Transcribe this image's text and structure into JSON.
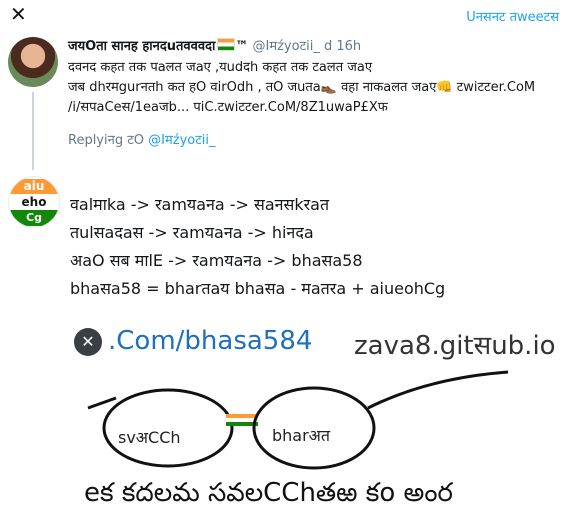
{
  "header": {
    "close_icon": "close-icon",
    "link": "Uनसनट तweeटस"
  },
  "parent": {
    "name": "जयOता सानह हानदuतवववदा",
    "badge": "™",
    "handle": "@Iमźyoटii_",
    "time": "d 16h",
    "lines": [
      "दवनद कहत तक पaलत जaए ,यudदh कहत तक टaलत जaए",
      "जब dhरमgurनतh कत हO वirOdh , तO जuतa👞 वहा नाकaलत जaए👊 टwiटटer.CoM",
      "/i/सपaCeस/1eaजb...  पiC.टwiटटer.CoM/8Z1uwaP£Xफ"
    ],
    "replying_prefix": "Replyiनg टO",
    "replying_handle": "@Iमźyoटii_"
  },
  "tweet": {
    "avatar_line1": "aiu",
    "avatar_line2": "eho",
    "avatar_line3": "Cg",
    "lines": [
      "वalमाka -> रamयaनa -> सaनसkरaत",
      "तulसaदaस -> रamयaनa -> hiनदa",
      "अaO सब माlE -> रamयaनa -> bhaसa58",
      "bhaसa58 = bharतaय bhaसa - मaतरa + aiueohCg"
    ]
  },
  "media": {
    "close_icon": "close-icon",
    "url_text": ".Com/bhasa584",
    "site_text": "zava8.gitसub.io",
    "left_lens": "svअCCh",
    "right_lens": "bharअत",
    "bottom_text": "eక కదలమ సవలCChతఱ కo అంర"
  }
}
